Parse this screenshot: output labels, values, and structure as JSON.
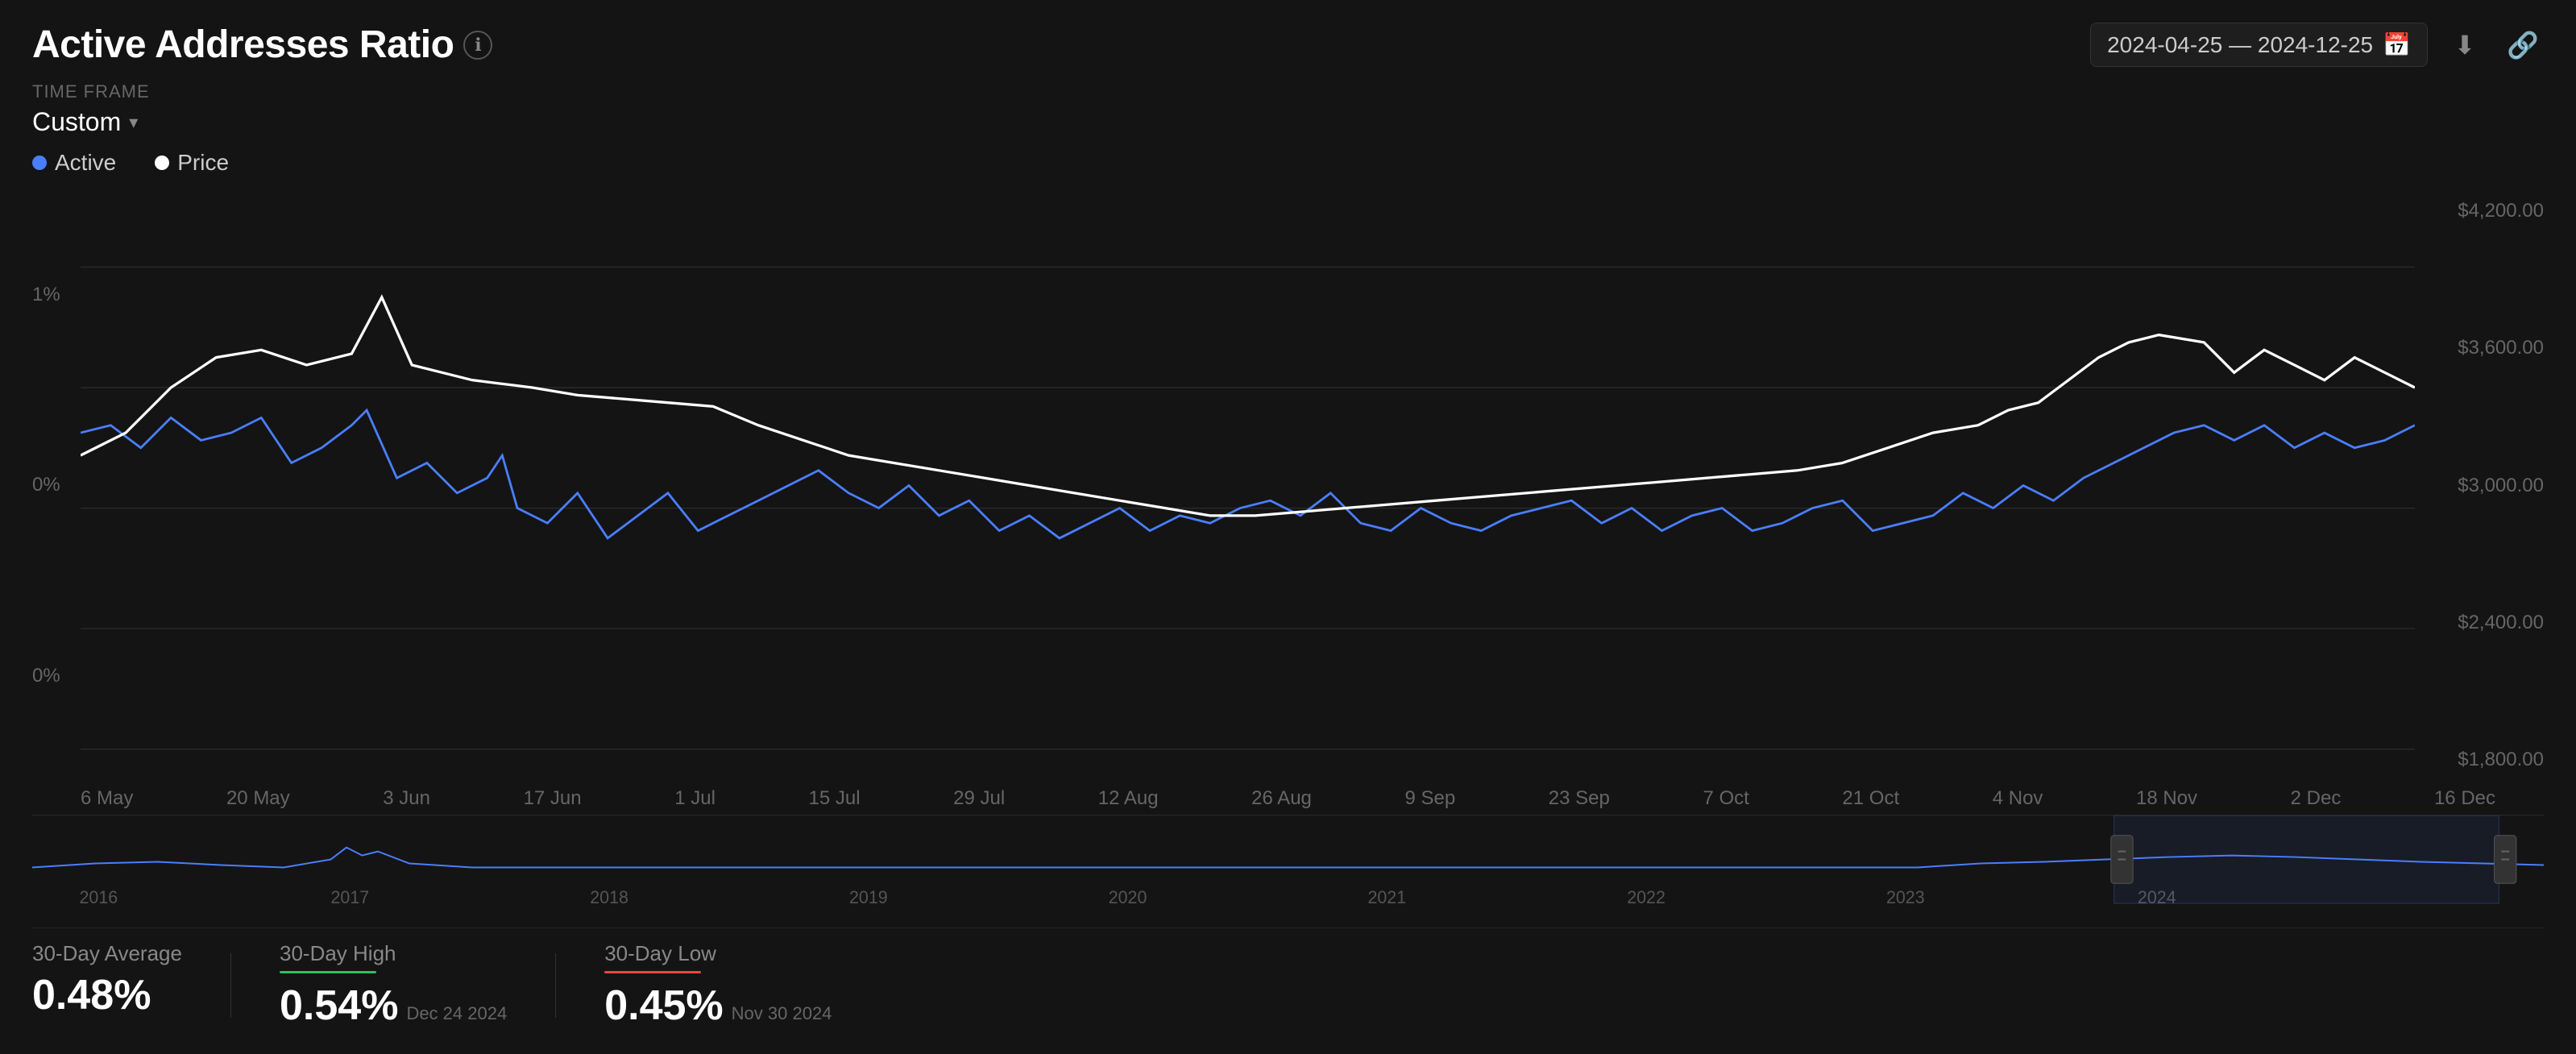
{
  "header": {
    "title": "Active Addresses Ratio",
    "info_icon": "ℹ",
    "date_range": "2024-04-25  —  2024-12-25",
    "download_icon": "⬇",
    "share_icon": "🔗",
    "calendar_icon": "📅"
  },
  "timeframe": {
    "label": "TIME FRAME",
    "value": "Custom",
    "chevron": "▾"
  },
  "legend": {
    "items": [
      {
        "label": "Active",
        "color": "blue"
      },
      {
        "label": "Price",
        "color": "white"
      }
    ]
  },
  "y_axis_right": {
    "values": [
      "$4,200.00",
      "$3,600.00",
      "$3,000.00",
      "$2,400.00",
      "$1,800.00"
    ]
  },
  "y_axis_left": {
    "values": [
      "1%",
      "0%",
      "0%"
    ]
  },
  "x_axis": {
    "labels": [
      "6 May",
      "20 May",
      "3 Jun",
      "17 Jun",
      "1 Jul",
      "15 Jul",
      "29 Jul",
      "12 Aug",
      "26 Aug",
      "9 Sep",
      "23 Sep",
      "7 Oct",
      "21 Oct",
      "4 Nov",
      "18 Nov",
      "2 Dec",
      "16 Dec"
    ]
  },
  "mini_chart": {
    "year_labels": [
      "2016",
      "2017",
      "2018",
      "2019",
      "2020",
      "2021",
      "2022",
      "2023",
      "2024"
    ]
  },
  "stats": {
    "average": {
      "label": "30-Day Average",
      "value": "0.48%",
      "date": ""
    },
    "high": {
      "label": "30-Day High",
      "value": "0.54%",
      "date": "Dec 24 2024",
      "indicator": "green"
    },
    "low": {
      "label": "30-Day Low",
      "value": "0.45%",
      "date": "Nov 30 2024",
      "indicator": "red"
    }
  }
}
